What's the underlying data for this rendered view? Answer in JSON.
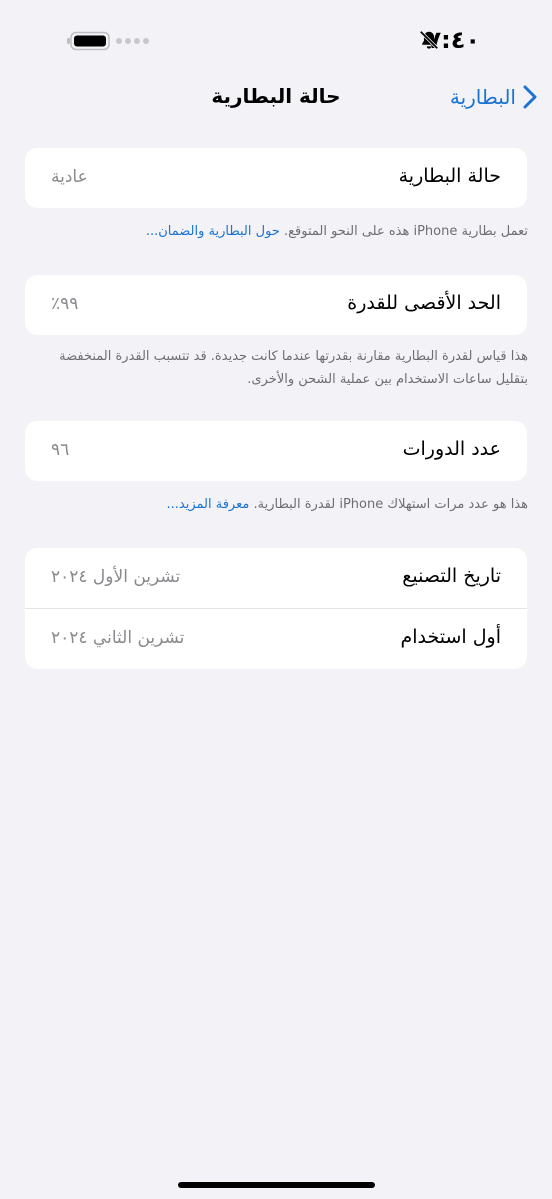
{
  "status_bar": {
    "time": "٧:٤٠",
    "bell_icon": "bell-slash-icon",
    "battery_icon": "battery-icon"
  },
  "nav": {
    "back_label": "البطارية",
    "title": "حالة البطارية",
    "accent": "#1a73d1"
  },
  "battery_health": {
    "label": "حالة البطارية",
    "value": "عادية",
    "footnote": "تعمل بطارية iPhone هذه على النحو المتوقع.",
    "footnote_link": "حول البطارية والضمان..."
  },
  "maximum_capacity": {
    "label": "الحد الأقصى للقدرة",
    "value": "٩٩٪",
    "footnote": "هذا قياس لقدرة البطارية مقارنة بقدرتها عندما كانت جديدة. قد تتسبب القدرة المنخفضة بتقليل ساعات الاستخدام بين عملية الشحن والأخرى."
  },
  "cycle_count": {
    "label": "عدد الدورات",
    "value": "٩٦",
    "footnote": "هذا هو عدد مرات استهلاك iPhone لقدرة البطارية.",
    "footnote_link": "معرفة المزيد..."
  },
  "dates": {
    "manufacture_label": "تاريخ التصنيع",
    "manufacture_value": "تشرين الأول ٢٠٢٤",
    "first_use_label": "أول استخدام",
    "first_use_value": "تشرين الثاني ٢٠٢٤"
  }
}
